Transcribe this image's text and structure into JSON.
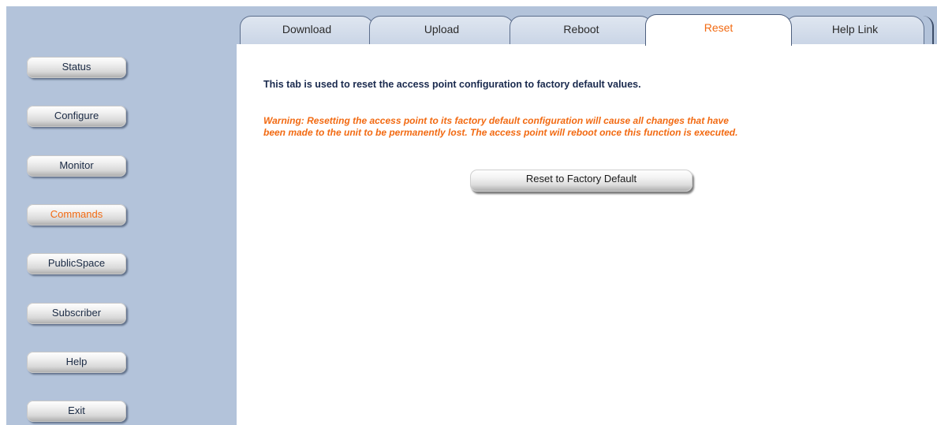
{
  "sidebar": {
    "items": [
      {
        "label": "Status"
      },
      {
        "label": "Configure"
      },
      {
        "label": "Monitor"
      },
      {
        "label": "Commands"
      },
      {
        "label": "PublicSpace"
      },
      {
        "label": "Subscriber"
      },
      {
        "label": "Help"
      },
      {
        "label": "Exit"
      }
    ],
    "active": "Commands"
  },
  "tabs": [
    {
      "label": "Download"
    },
    {
      "label": "Upload"
    },
    {
      "label": "Reboot"
    },
    {
      "label": "Reset"
    },
    {
      "label": "Help Link"
    }
  ],
  "active_tab": "Reset",
  "main": {
    "description": "This tab is used to reset the access point configuration to factory default values.",
    "warning_line1": "Warning: Resetting the access point to its factory default configuration will cause all changes that have",
    "warning_line2": "been made to the unit to be permanently lost. The access point will reboot once this function is executed.",
    "reset_button_label": "Reset to Factory Default"
  },
  "colors": {
    "sidebar_bg": "#b3c3da",
    "accent": "#f26a12",
    "heading_text": "#1a2a4e"
  }
}
